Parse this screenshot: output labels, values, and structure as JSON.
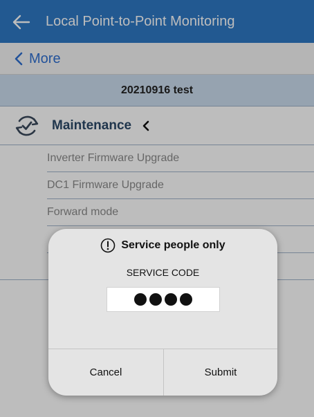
{
  "appbar": {
    "title": "Local Point-to-Point Monitoring",
    "back_icon": "arrow-left-icon"
  },
  "nav": {
    "more_label": "More",
    "back_icon": "chevron-left-icon"
  },
  "device": {
    "name": "20210916 test"
  },
  "section": {
    "label": "Maintenance",
    "icon": "refresh-check-icon",
    "collapse_icon": "chevron-left-icon",
    "items": [
      {
        "label": "Inverter Firmware Upgrade"
      },
      {
        "label": "DC1 Firmware Upgrade"
      },
      {
        "label": "Forward mode"
      }
    ]
  },
  "dialog": {
    "title": "Service people only",
    "title_icon": "exclamation-circle-icon",
    "field_label": "SERVICE CODE",
    "masked_length": 4,
    "cancel_label": "Cancel",
    "submit_label": "Submit"
  },
  "colors": {
    "appbar": "#2f78c4",
    "link": "#2f6fd0",
    "device_header": "#cbdcee",
    "section_label": "#2c4968",
    "item_text": "#8a8a8a",
    "dialog_bg": "#e4e4e4"
  }
}
